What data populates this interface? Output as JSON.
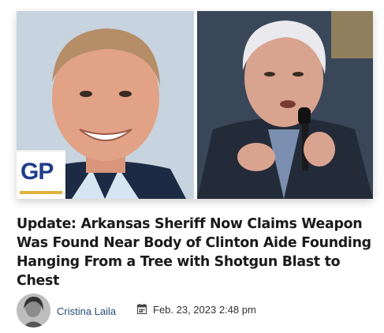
{
  "article": {
    "logo_text": "GP",
    "title": "Update: Arkansas Sheriff Now Claims Weapon Was Found Near Body of Clinton Aide Founding Hanging From a Tree with Shotgun Blast to Chest",
    "author": "Cristina Laila",
    "date": "Feb. 23, 2023 2:48 pm"
  },
  "icons": {
    "date": "calendar-icon"
  },
  "colors": {
    "logo_blue": "#1f3c8a",
    "logo_gold": "#e0b43a",
    "author_link": "#2a4d7a"
  }
}
